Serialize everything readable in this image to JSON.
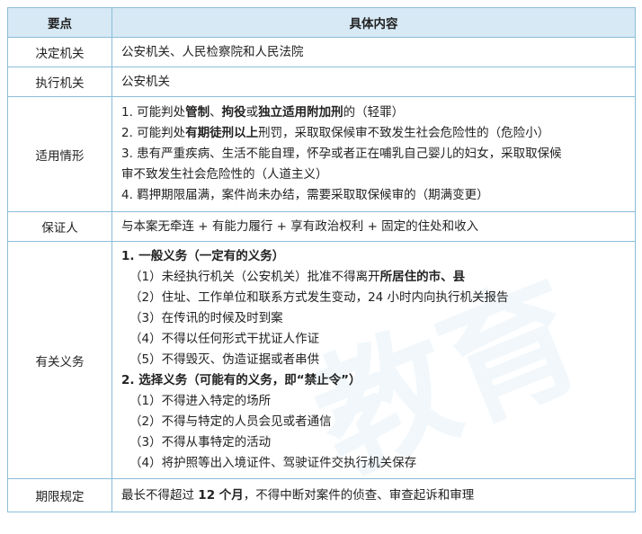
{
  "header": {
    "col1": "要点",
    "col2": "具体内容"
  },
  "rows": {
    "decide": {
      "key": "决定机关",
      "value": "公安机关、人民检察院和人民法院"
    },
    "exec": {
      "key": "执行机关",
      "value": "公安机关"
    },
    "cases": {
      "key": "适用情形",
      "l1": {
        "a": "1. 可能判处",
        "b1": "管制",
        "c": "、",
        "b2": "拘役",
        "d": "或",
        "b3": "独立适用附加刑",
        "e": "的（轻罪）"
      },
      "l2": {
        "a": "2. 可能判处",
        "b": "有期徒刑以上",
        "c": "刑罚，采取取保候审不致发生社会危险性的（危险小）"
      },
      "l3": "3. 患有严重疾病、生活不能自理，怀孕或者正在哺乳自己婴儿的妇女，采取取保候",
      "l4": "审不致发生社会危险性的（人道主义）",
      "l5": "4. 羁押期限届满，案件尚未办结，需要采取取保候审的（期满变更）"
    },
    "guarantor": {
      "key": "保证人",
      "value": "与本案无牵连 + 有能力履行 + 享有政治权利 + 固定的住处和收入"
    },
    "duties": {
      "key": "有关义务",
      "h1": "1. 一般义务（一定有的义务）",
      "g1": {
        "a": "（1）未经执行机关（公安机关）批准不得离开",
        "b": "所居住的市、县"
      },
      "g2": "（2）住址、工作单位和联系方式发生变动，24 小时内向执行机关报告",
      "g3": "（3）在传讯的时候及时到案",
      "g4": "（4）不得以任何形式干扰证人作证",
      "g5": "（5）不得毁灭、伪造证据或者串供",
      "h2": "2. 选择义务（可能有的义务，即“禁止令”）",
      "s1": "（1）不得进入特定的场所",
      "s2": "（2）不得与特定的人员会见或者通信",
      "s3": "（3）不得从事特定的活动",
      "s4": "（4）将护照等出入境证件、驾驶证件交执行机关保存"
    },
    "term": {
      "key": "期限规定",
      "a": "最长不得超过 ",
      "b": "12 个月",
      "c": "，不得中断对案件的侦查、审查起诉和审理"
    }
  },
  "colors": {
    "border": "#8bbdd9",
    "header_bg": "#d6e9f5"
  }
}
